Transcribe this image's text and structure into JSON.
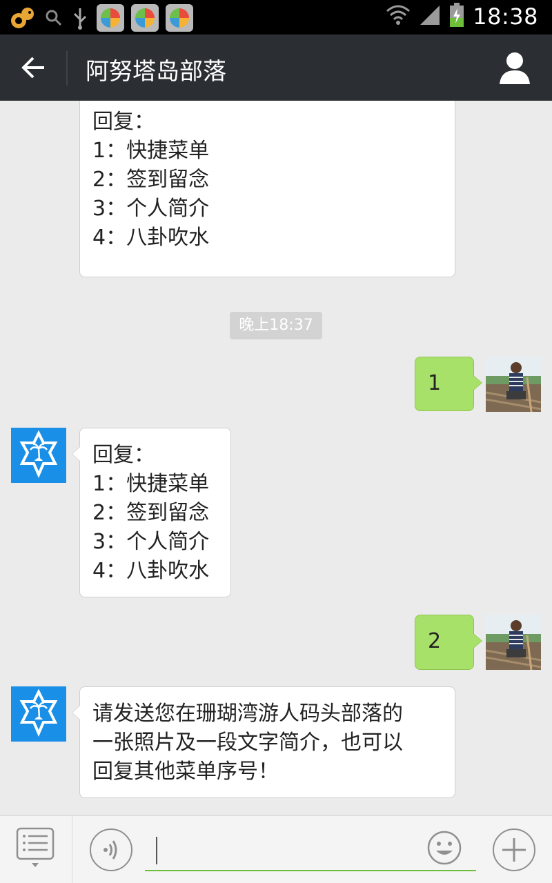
{
  "status_bar": {
    "time": "18:38",
    "icons": [
      "uc-browser-squirrel-icon",
      "search-icon",
      "usb-icon",
      "app-store-icon",
      "app-store-icon",
      "app-store-icon",
      "wifi-icon",
      "signal-icon",
      "battery-charging-icon"
    ]
  },
  "header": {
    "back_icon": "arrow-left-icon",
    "title": "阿努塔岛部落",
    "profile_icon": "person-icon"
  },
  "messages": [
    {
      "sender": "bot",
      "lines": [
        "回复：",
        "1：快捷菜单",
        "2：签到留念",
        "3：个人简介",
        "4：八卦吹水"
      ]
    },
    {
      "type": "timestamp",
      "text": "晚上18:37"
    },
    {
      "sender": "user",
      "lines": [
        "1"
      ]
    },
    {
      "sender": "bot",
      "lines": [
        "回复：",
        "1：快捷菜单",
        "2：签到留念",
        "3：个人简介",
        "4：八卦吹水"
      ]
    },
    {
      "sender": "user",
      "lines": [
        "2"
      ]
    },
    {
      "sender": "bot",
      "lines": [
        "请发送您在珊瑚湾游人码头部落的",
        "一张照片及一段文字简介，也可以",
        "回复其他菜单序号！"
      ]
    }
  ],
  "input_bar": {
    "menu_icon": "list-menu-icon",
    "voice_icon": "voice-icon",
    "input_value": "",
    "emoji_icon": "smiley-icon",
    "plus_icon": "plus-icon"
  },
  "colors": {
    "header_bg": "#2b2f33",
    "chat_bg": "#ebebeb",
    "outgoing_bubble": "#a8e169",
    "incoming_bubble": "#ffffff",
    "bot_avatar": "#1a8fe8",
    "input_accent": "#6dbf3a"
  }
}
